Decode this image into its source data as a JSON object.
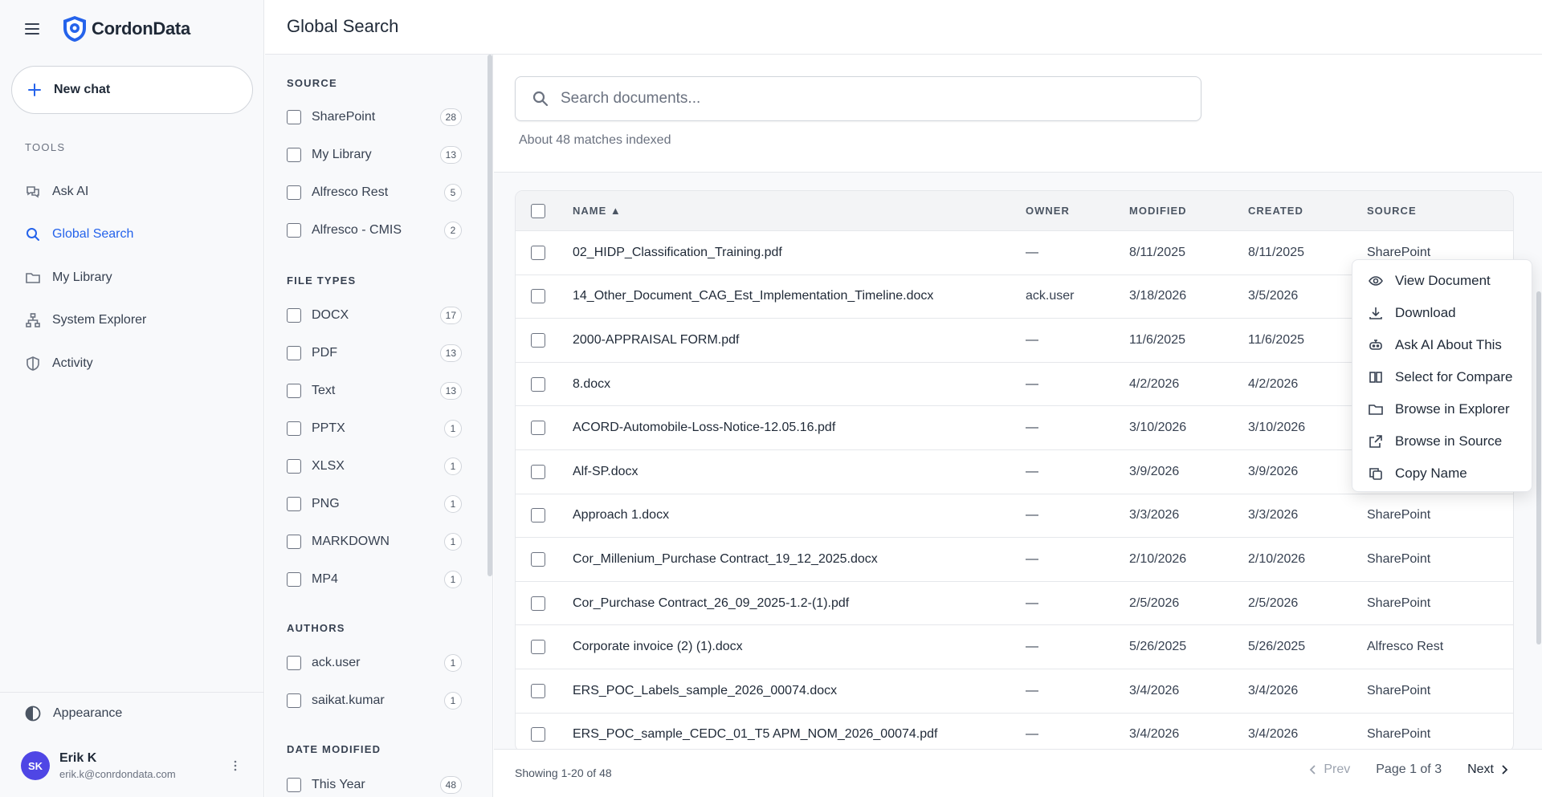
{
  "app": {
    "name": "CordonData"
  },
  "sidebar": {
    "new_chat_label": "New chat",
    "tools_label": "TOOLS",
    "items": [
      {
        "label": "Ask AI",
        "icon": "chat-icon",
        "active": false
      },
      {
        "label": "Global Search",
        "icon": "search-icon",
        "active": true
      },
      {
        "label": "My Library",
        "icon": "folder-icon",
        "active": false
      },
      {
        "label": "System Explorer",
        "icon": "network-icon",
        "active": false
      },
      {
        "label": "Activity",
        "icon": "shield-icon",
        "active": false
      }
    ],
    "appearance_label": "Appearance",
    "user": {
      "initials": "SK",
      "name": "Erik K",
      "email": "erik.k@conrdondata.com"
    }
  },
  "header": {
    "title": "Global Search"
  },
  "filters": {
    "source": {
      "title": "SOURCE",
      "items": [
        {
          "label": "SharePoint",
          "count": "28"
        },
        {
          "label": "My Library",
          "count": "13"
        },
        {
          "label": "Alfresco Rest",
          "count": "5"
        },
        {
          "label": "Alfresco - CMIS",
          "count": "2"
        }
      ]
    },
    "file_types": {
      "title": "FILE TYPES",
      "items": [
        {
          "label": "DOCX",
          "count": "17"
        },
        {
          "label": "PDF",
          "count": "13"
        },
        {
          "label": "Text",
          "count": "13"
        },
        {
          "label": "PPTX",
          "count": "1"
        },
        {
          "label": "XLSX",
          "count": "1"
        },
        {
          "label": "PNG",
          "count": "1"
        },
        {
          "label": "MARKDOWN",
          "count": "1"
        },
        {
          "label": "MP4",
          "count": "1"
        }
      ]
    },
    "authors": {
      "title": "AUTHORS",
      "items": [
        {
          "label": "ack.user",
          "count": "1"
        },
        {
          "label": "saikat.kumar",
          "count": "1"
        }
      ]
    },
    "date_modified": {
      "title": "DATE MODIFIED",
      "items": [
        {
          "label": "This Year",
          "count": "48"
        }
      ]
    }
  },
  "search": {
    "placeholder": "Search documents...",
    "value": "",
    "match_count": "About 48 matches indexed"
  },
  "table": {
    "columns": {
      "name": "NAME ▲",
      "owner": "OWNER",
      "modified": "MODIFIED",
      "created": "CREATED",
      "source": "SOURCE"
    },
    "rows": [
      {
        "name": "02_HIDP_Classification_Training.pdf",
        "owner": "—",
        "modified": "8/11/2025",
        "created": "8/11/2025",
        "source": "SharePoint"
      },
      {
        "name": "14_Other_Document_CAG_Est_Implementation_Timeline.docx",
        "owner": "ack.user",
        "modified": "3/18/2026",
        "created": "3/5/2026",
        "source": ""
      },
      {
        "name": "2000-APPRAISAL FORM.pdf",
        "owner": "—",
        "modified": "11/6/2025",
        "created": "11/6/2025",
        "source": ""
      },
      {
        "name": "8.docx",
        "owner": "—",
        "modified": "4/2/2026",
        "created": "4/2/2026",
        "source": ""
      },
      {
        "name": "ACORD-Automobile-Loss-Notice-12.05.16.pdf",
        "owner": "—",
        "modified": "3/10/2026",
        "created": "3/10/2026",
        "source": ""
      },
      {
        "name": "Alf-SP.docx",
        "owner": "—",
        "modified": "3/9/2026",
        "created": "3/9/2026",
        "source": ""
      },
      {
        "name": "Approach 1.docx",
        "owner": "—",
        "modified": "3/3/2026",
        "created": "3/3/2026",
        "source": "SharePoint"
      },
      {
        "name": "Cor_Millenium_Purchase Contract_19_12_2025.docx",
        "owner": "—",
        "modified": "2/10/2026",
        "created": "2/10/2026",
        "source": "SharePoint"
      },
      {
        "name": "Cor_Purchase Contract_26_09_2025-1.2-(1).pdf",
        "owner": "—",
        "modified": "2/5/2026",
        "created": "2/5/2026",
        "source": "SharePoint"
      },
      {
        "name": "Corporate invoice (2) (1).docx",
        "owner": "—",
        "modified": "5/26/2025",
        "created": "5/26/2025",
        "source": "Alfresco Rest"
      },
      {
        "name": "ERS_POC_Labels_sample_2026_00074.docx",
        "owner": "—",
        "modified": "3/4/2026",
        "created": "3/4/2026",
        "source": "SharePoint"
      },
      {
        "name": "ERS_POC_sample_CEDC_01_T5 APM_NOM_2026_00074.pdf",
        "owner": "—",
        "modified": "3/4/2026",
        "created": "3/4/2026",
        "source": "SharePoint"
      }
    ]
  },
  "footer": {
    "showing": "Showing 1-20 of 48",
    "prev": "Prev",
    "page_info": "Page 1 of 3",
    "next": "Next"
  },
  "context_menu": {
    "items": [
      {
        "label": "View Document",
        "icon": "eye-icon"
      },
      {
        "label": "Download",
        "icon": "download-icon"
      },
      {
        "label": "Ask AI About This",
        "icon": "ai-icon"
      },
      {
        "label": "Select for Compare",
        "icon": "compare-icon"
      },
      {
        "label": "Browse in Explorer",
        "icon": "folder-icon"
      },
      {
        "label": "Browse in Source",
        "icon": "external-link-icon"
      },
      {
        "label": "Copy Name",
        "icon": "copy-icon"
      }
    ]
  },
  "colors": {
    "accent": "#2563eb",
    "avatar": "#4f46e5"
  }
}
